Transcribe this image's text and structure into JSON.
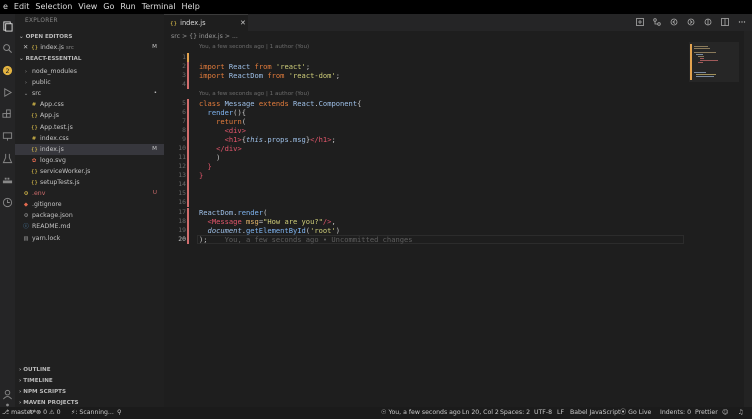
{
  "menu": [
    "e",
    "Edit",
    "Selection",
    "View",
    "Go",
    "Run",
    "Terminal",
    "Help"
  ],
  "sidebar": {
    "title": "EXPLORER",
    "open_editors": "OPEN EDITORS",
    "open_file": {
      "name": "index.js",
      "folder": "src",
      "badge": "M"
    },
    "project": "REACT-ESSENTIAL",
    "tree": [
      {
        "name": "node_modules",
        "kind": "folder-closed",
        "indent": 1
      },
      {
        "name": "public",
        "kind": "folder-closed",
        "indent": 1
      },
      {
        "name": "src",
        "kind": "folder-open",
        "indent": 1,
        "badge": "•"
      },
      {
        "name": "App.css",
        "kind": "css",
        "indent": 2
      },
      {
        "name": "App.js",
        "kind": "js",
        "indent": 2
      },
      {
        "name": "App.test.js",
        "kind": "js",
        "indent": 2
      },
      {
        "name": "index.css",
        "kind": "css",
        "indent": 2
      },
      {
        "name": "index.js",
        "kind": "js",
        "indent": 2,
        "badge": "M",
        "selected": true
      },
      {
        "name": "logo.svg",
        "kind": "svg",
        "indent": 2
      },
      {
        "name": "serviceWorker.js",
        "kind": "js",
        "indent": 2
      },
      {
        "name": "setupTests.js",
        "kind": "js",
        "indent": 2
      },
      {
        "name": ".env",
        "kind": "env",
        "indent": 1,
        "badge": "U"
      },
      {
        "name": ".gitignore",
        "kind": "git",
        "indent": 1
      },
      {
        "name": "package.json",
        "kind": "json",
        "indent": 1
      },
      {
        "name": "README.md",
        "kind": "md",
        "indent": 1
      },
      {
        "name": "yarn.lock",
        "kind": "lock",
        "indent": 1
      }
    ],
    "panels": [
      "OUTLINE",
      "TIMELINE",
      "NPM SCRIPTS",
      "MAVEN PROJECTS"
    ]
  },
  "editor": {
    "tab": {
      "icon": "{}",
      "label": "index.js"
    },
    "breadcrumb": "src > {} index.js > ...",
    "blame_top": "You, a few seconds ago | 1 author (You)",
    "blame_class": "You, a few seconds ago | 1 author (You)",
    "inline_blame": "You, a few seconds ago • Uncommitted changes",
    "line_numbers": [
      "1",
      "2",
      "3",
      "4",
      "5",
      "6",
      "7",
      "8",
      "9",
      "10",
      "11",
      "12",
      "13",
      "14",
      "15",
      "16",
      "17",
      "18",
      "19",
      "20"
    ]
  },
  "statusbar": {
    "branch": "master*",
    "sync": "↻",
    "problems": "⊗ 0  ⚠ 0",
    "scanning": "⚡: Scanning...",
    "blame": "You, a few seconds ago",
    "position": "Ln 20, Col 2",
    "spaces": "Spaces: 2",
    "encoding": "UTF-8",
    "eol": "LF",
    "language": "Babel JavaScript",
    "golive": "Go Live",
    "indents": "Indents: 0",
    "formatter": "Prettier"
  },
  "colors": {
    "accent": "#e57d3c",
    "modified": "#e3a34f",
    "deleted": "#d16d6d"
  }
}
